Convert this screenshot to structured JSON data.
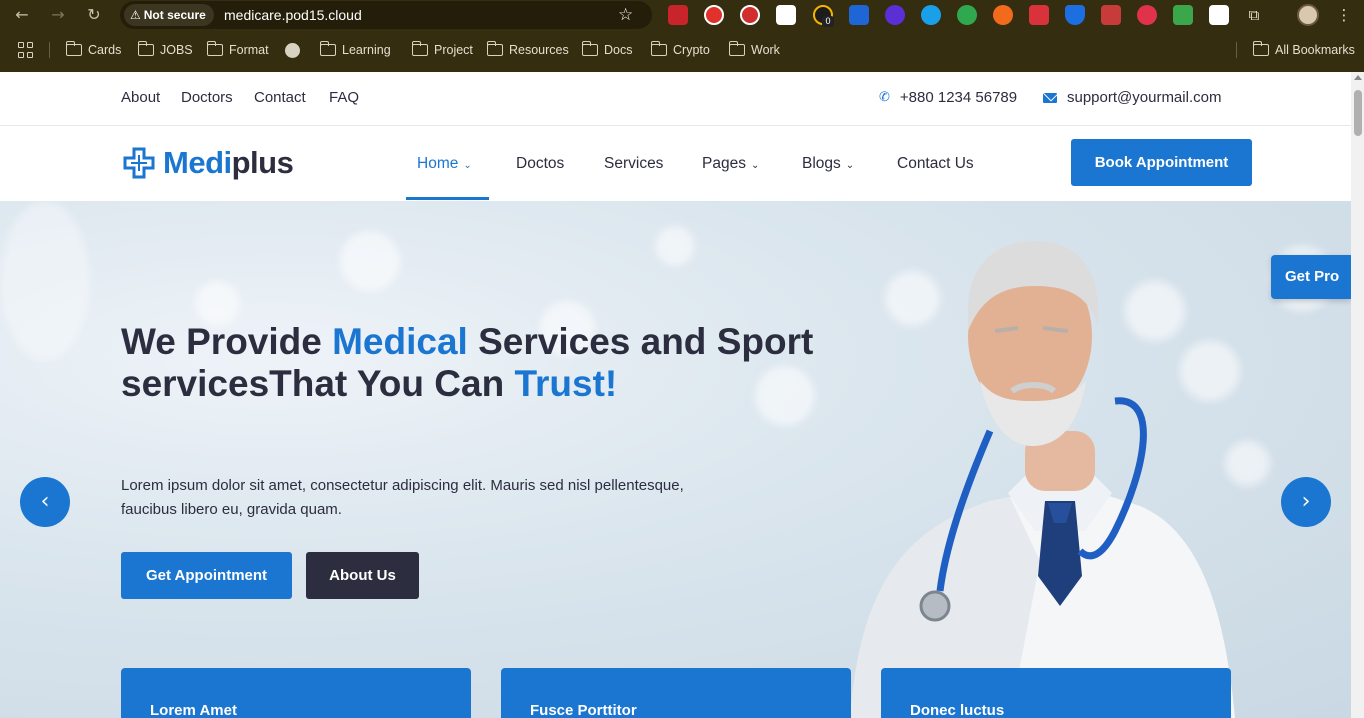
{
  "browser": {
    "security_label": "Not secure",
    "url": "medicare.pod15.cloud",
    "extension_badge": "0",
    "bookmarks": [
      "Cards",
      "JOBS",
      "Format",
      "Learning",
      "Project",
      "Resources",
      "Docs",
      "Crypto",
      "Work"
    ],
    "all_bookmarks": "All Bookmarks"
  },
  "topbar": {
    "links": [
      "About",
      "Doctors",
      "Contact",
      "FAQ"
    ],
    "phone": "+880 1234 56789",
    "email": "support@yourmail.com"
  },
  "nav": {
    "logo_accent": "Medi",
    "logo_rest": "plus",
    "menu": [
      "Home",
      "Doctos",
      "Services",
      "Pages",
      "Blogs",
      "Contact Us"
    ],
    "book_button": "Book Appointment"
  },
  "hero": {
    "title_1": "We Provide ",
    "title_hl_1": "Medical",
    "title_2": " Services and Sport servicesThat You Can ",
    "title_hl_2": "Trust!",
    "description": "Lorem ipsum dolor sit amet, consectetur adipiscing elit. Mauris sed nisl pellentesque, faucibus libero eu, gravida quam.",
    "btn_primary": "Get Appointment",
    "btn_secondary": "About Us"
  },
  "features": [
    "Lorem Amet",
    "Fusce Porttitor",
    "Donec luctus"
  ],
  "get_pro": "Get Pro",
  "colors": {
    "primary": "#1a76d1",
    "dark": "#2c2d3f",
    "chrome": "#352d10"
  }
}
